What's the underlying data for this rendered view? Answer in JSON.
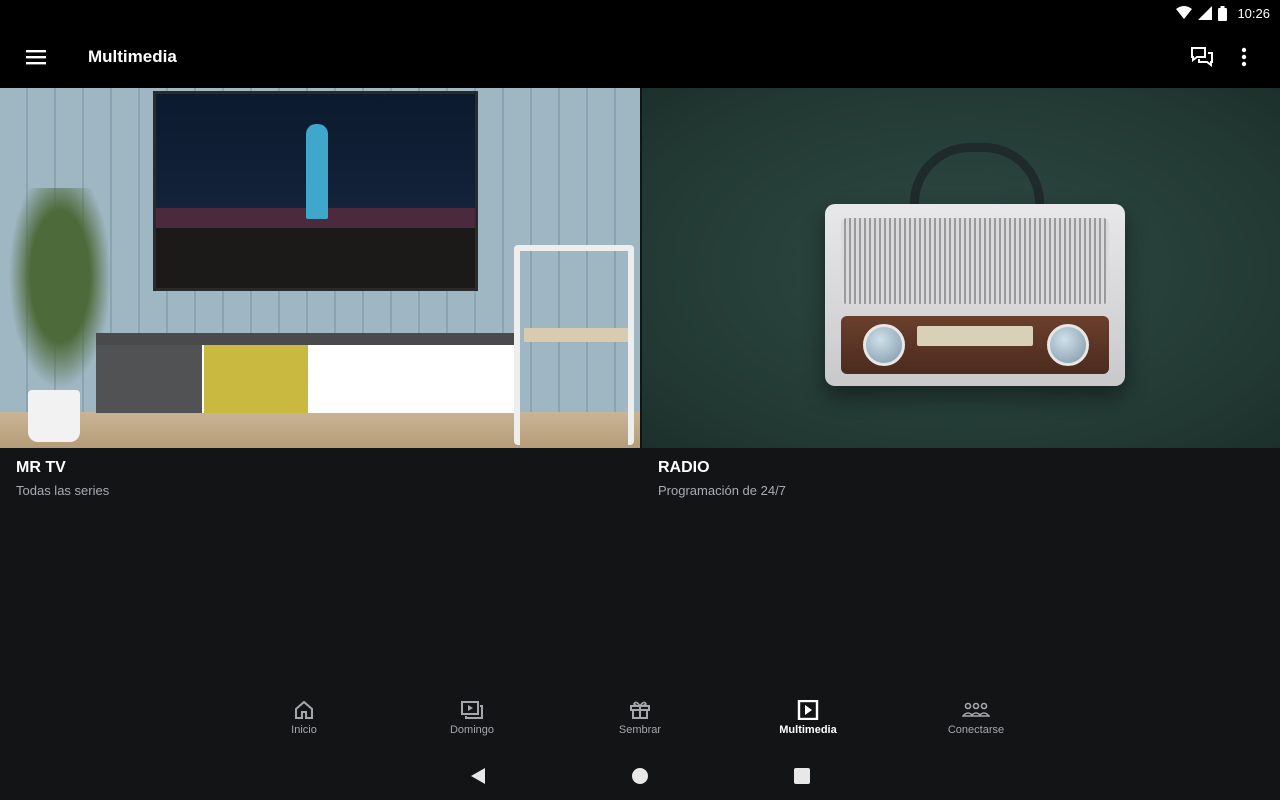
{
  "status_bar": {
    "time": "10:26",
    "icons": [
      "wifi-icon",
      "signal-icon",
      "battery-icon"
    ]
  },
  "app_bar": {
    "title": "Multimedia",
    "menu_icon": "hamburger-icon",
    "actions": [
      "chat-icon",
      "overflow-menu-icon"
    ]
  },
  "cards": [
    {
      "title": "MR TV",
      "subtitle": "Todas las series",
      "image": "living-room-tv-photo"
    },
    {
      "title": "RADIO",
      "subtitle": "Programación de 24/7",
      "image": "vintage-radio-photo"
    }
  ],
  "bottom_nav": {
    "items": [
      {
        "label": "Inicio",
        "icon": "home-icon"
      },
      {
        "label": "Domingo",
        "icon": "domingo-icon"
      },
      {
        "label": "Sembrar",
        "icon": "gift-icon"
      },
      {
        "label": "Multimedia",
        "icon": "play-box-icon",
        "active": true
      },
      {
        "label": "Conectarse",
        "icon": "people-icon"
      }
    ]
  },
  "system_nav": [
    "back-icon",
    "home-circle-icon",
    "recents-icon"
  ],
  "colors": {
    "app_bar": "#000000",
    "background": "#131416",
    "active": "#ffffff",
    "inactive": "#a5a7ab",
    "subtitle": "#a9abb0"
  }
}
